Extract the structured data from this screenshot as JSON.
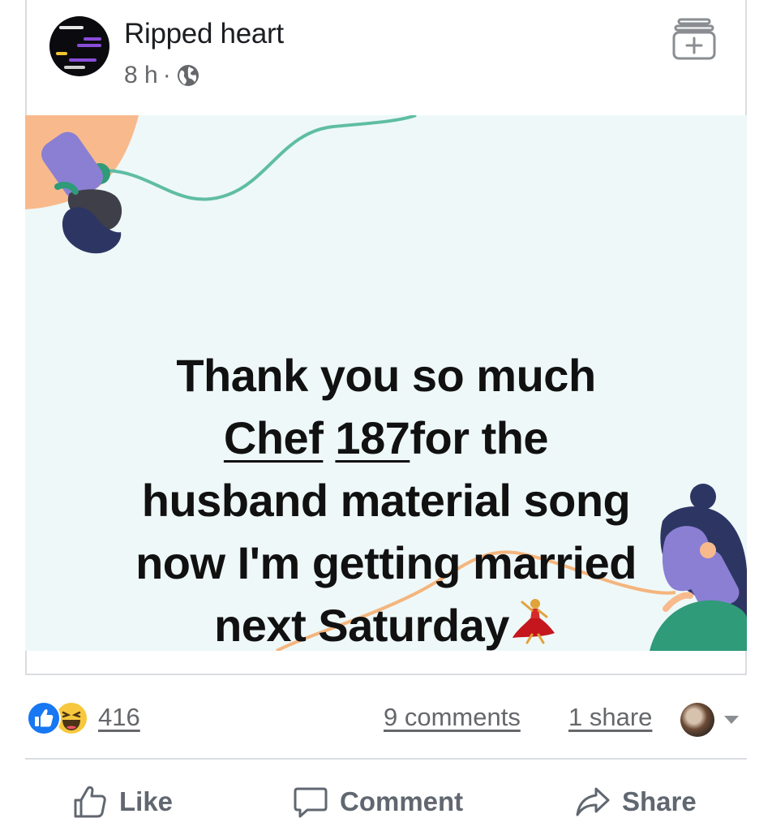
{
  "post": {
    "author": "Ripped heart",
    "time": "8 h",
    "separator": "·",
    "privacy_icon": "globe-icon",
    "add_icon": "add-to-collection-icon"
  },
  "image": {
    "message_lines": [
      "Thank you so much",
      "Chef",
      "187",
      "for the",
      "husband material song",
      "now I'm getting married",
      "next Saturday"
    ],
    "emoji": "dancer-icon",
    "colors": {
      "background": "#eef8f8",
      "teal_wire": "#5fbda3",
      "orange_wire": "#f4b57d",
      "phone_purple": "#8b7fd4",
      "hair_navy": "#2d3663",
      "shirt_green": "#2f9b78"
    }
  },
  "stats": {
    "reactions": [
      "like-icon",
      "haha-icon"
    ],
    "reaction_count": "416",
    "comments": "9 comments",
    "shares": "1 share"
  },
  "actions": {
    "like": "Like",
    "comment": "Comment",
    "share": "Share"
  }
}
